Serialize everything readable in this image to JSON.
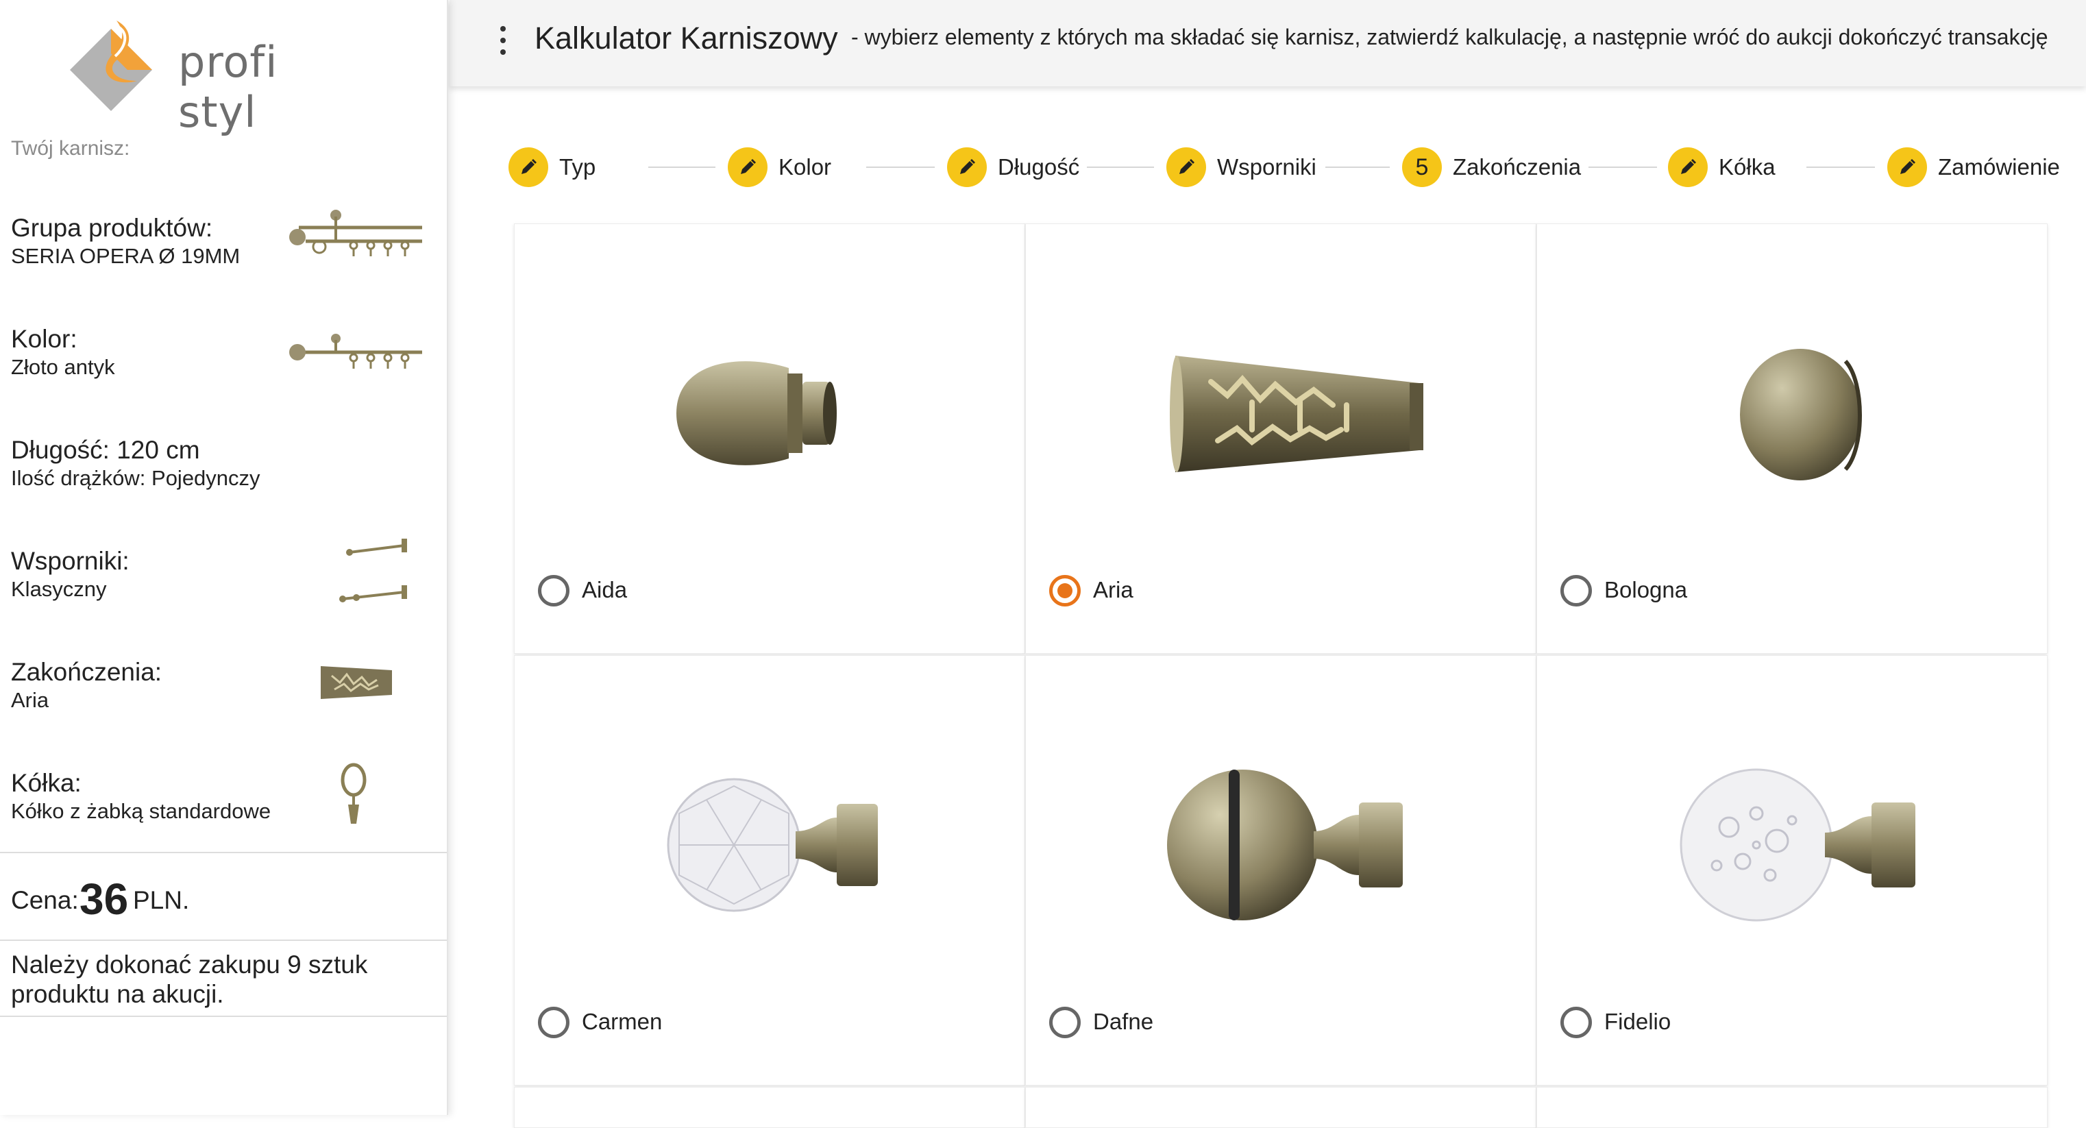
{
  "brand": {
    "name": "profi styl"
  },
  "sidebar": {
    "your_rod_label": "Twój karnisz:",
    "rows": [
      {
        "label": "Grupa produktów:",
        "value": "SERIA OPERA Ø 19MM"
      },
      {
        "label": "Kolor:",
        "value": "Złoto antyk"
      },
      {
        "label": "Długość: 120 cm",
        "value": "Ilość drążków: Pojedynczy"
      },
      {
        "label": "Wsporniki:",
        "value": "Klasyczny"
      },
      {
        "label": "Zakończenia:",
        "value": "Aria"
      },
      {
        "label": "Kółka:",
        "value": "Kółko z żabką standardowe"
      }
    ],
    "price_label": "Cena:",
    "price_value": "36",
    "price_currency": "PLN.",
    "note": "Należy dokonać zakupu 9 sztuk produktu na akucji."
  },
  "header": {
    "title": "Kalkulator Karniszowy",
    "subtitle": "- wybierz elementy z których ma składać się karnisz, zatwierdź kalkulację, a następnie wróć do aukcji dokończyć transakcję"
  },
  "stepper": {
    "steps": [
      {
        "label": "Typ",
        "icon": "pencil-icon"
      },
      {
        "label": "Kolor",
        "icon": "pencil-icon"
      },
      {
        "label": "Długość",
        "icon": "pencil-icon"
      },
      {
        "label": "Wsporniki",
        "icon": "pencil-icon"
      },
      {
        "label": "Zakończenia",
        "number": "5"
      },
      {
        "label": "Kółka",
        "icon": "pencil-icon"
      },
      {
        "label": "Zamówienie",
        "icon": "pencil-icon"
      }
    ],
    "active_step": 5
  },
  "options": [
    {
      "label": "Aida",
      "selected": false
    },
    {
      "label": "Aria",
      "selected": true
    },
    {
      "label": "Bologna",
      "selected": false
    },
    {
      "label": "Carmen",
      "selected": false
    },
    {
      "label": "Dafne",
      "selected": false
    },
    {
      "label": "Fidelio",
      "selected": false
    }
  ],
  "colors": {
    "accent": "#f5c518",
    "radio_selected": "#e8741a",
    "metal": "#8a7f55"
  }
}
